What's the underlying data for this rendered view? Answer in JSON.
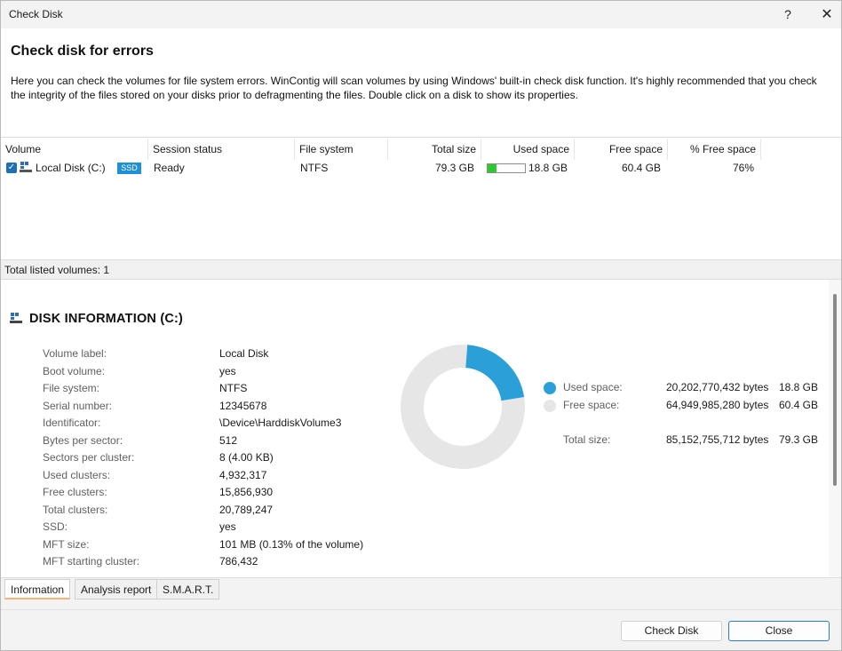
{
  "window": {
    "title": "Check Disk",
    "help_label": "?",
    "close_label": "✕"
  },
  "header": {
    "title": "Check disk for errors",
    "description": "Here you can check the volumes for file system errors. WinContig will scan volumes by using Windows' built-in check disk function. It's highly recommended that you check the integrity of the files stored on your disks prior to defragmenting the files. Double click on a disk to show its properties."
  },
  "volume_table": {
    "columns": [
      "Volume",
      "Session status",
      "File system",
      "Total size",
      "Used space",
      "Free space",
      "% Free space"
    ],
    "rows": [
      {
        "checked": true,
        "volume": "Local Disk (C:)",
        "badge": "SSD",
        "session_status": "Ready",
        "file_system": "NTFS",
        "total_size": "79.3 GB",
        "used_space": "18.8 GB",
        "used_fraction": 0.24,
        "free_space": "60.4 GB",
        "percent_free": "76%"
      }
    ]
  },
  "status": {
    "total_listed": "Total listed volumes: 1"
  },
  "disk_info": {
    "title": "DISK INFORMATION (C:)",
    "properties": [
      {
        "key": "Volume label:",
        "value": "Local Disk"
      },
      {
        "key": "Boot volume:",
        "value": "yes"
      },
      {
        "key": "File system:",
        "value": "NTFS"
      },
      {
        "key": "Serial number:",
        "value": "12345678"
      },
      {
        "key": "Identificator:",
        "value": "\\Device\\HarddiskVolume3"
      },
      {
        "key": "Bytes per sector:",
        "value": "512"
      },
      {
        "key": "Sectors per cluster:",
        "value": "8 (4.00 KB)"
      },
      {
        "key": "Used clusters:",
        "value": "4,932,317"
      },
      {
        "key": "Free clusters:",
        "value": "15,856,930"
      },
      {
        "key": "Total clusters:",
        "value": "20,789,247"
      },
      {
        "key": "SSD:",
        "value": "yes"
      },
      {
        "key": "MFT size:",
        "value": "101 MB (0.13% of the volume)"
      },
      {
        "key": "MFT starting cluster:",
        "value": "786,432"
      }
    ],
    "legend": {
      "used_label": "Used space:",
      "used_bytes": "20,202,770,432 bytes",
      "used_gb": "18.8 GB",
      "free_label": "Free space:",
      "free_bytes": "64,949,985,280 bytes",
      "free_gb": "60.4 GB",
      "total_label": "Total size:",
      "total_bytes": "85,152,755,712 bytes",
      "total_gb": "79.3 GB"
    },
    "used_fraction": 0.237,
    "colors": {
      "used": "#2a9fd8",
      "free": "#e6e6e6"
    }
  },
  "tabs": [
    {
      "label": "Information",
      "active": true
    },
    {
      "label": "Analysis report",
      "active": false
    },
    {
      "label": "S.M.A.R.T.",
      "active": false
    }
  ],
  "buttons": {
    "check_disk": "Check Disk",
    "close": "Close"
  }
}
